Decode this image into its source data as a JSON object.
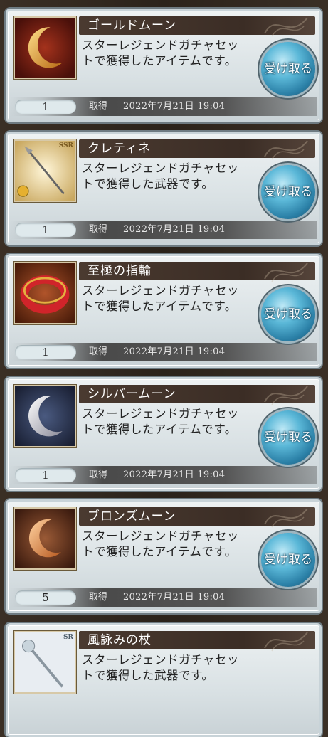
{
  "items": [
    {
      "name": "ゴールドムーン",
      "desc": "スターレジェンドガチャセットで獲得したアイテムです。",
      "qty": "1",
      "acq_label": "取得",
      "date": "2022年7月21日 19:04",
      "button": "受け取る",
      "icon": "gold-moon-icon",
      "colors": {
        "bg": "#7a1e12",
        "fg": "#e8a83a"
      }
    },
    {
      "name": "クレティネ",
      "desc": "スターレジェンドガチャセットで獲得した武器です。",
      "qty": "1",
      "acq_label": "取得",
      "date": "2022年7月21日 19:04",
      "button": "受け取る",
      "icon": "spear-icon",
      "badge": "SSR",
      "colors": {
        "bg": "#e9d9a8",
        "fg": "#8b8b8b"
      }
    },
    {
      "name": "至極の指輪",
      "desc": "スターレジェンドガチャセットで獲得したアイテムです。",
      "qty": "1",
      "acq_label": "取得",
      "date": "2022年7月21日 19:04",
      "button": "受け取る",
      "icon": "red-ring-icon",
      "colors": {
        "bg": "#7a3414",
        "fg": "#d0242a"
      }
    },
    {
      "name": "シルバームーン",
      "desc": "スターレジェンドガチャセットで獲得したアイテムです。",
      "qty": "1",
      "acq_label": "取得",
      "date": "2022年7月21日 19:04",
      "button": "受け取る",
      "icon": "silver-moon-icon",
      "colors": {
        "bg": "#2a3550",
        "fg": "#d8d8e0"
      }
    },
    {
      "name": "ブロンズムーン",
      "desc": "スターレジェンドガチャセットで獲得したアイテムです。",
      "qty": "5",
      "acq_label": "取得",
      "date": "2022年7月21日 19:04",
      "button": "受け取る",
      "icon": "bronze-moon-icon",
      "colors": {
        "bg": "#5a2e1c",
        "fg": "#e08a4a"
      }
    },
    {
      "name": "風詠みの杖",
      "desc": "スターレジェンドガチャセットで獲得した武器です。",
      "qty": "",
      "acq_label": "",
      "date": "",
      "button": "",
      "icon": "staff-icon",
      "badge": "SR",
      "colors": {
        "bg": "#dfe6ec",
        "fg": "#9aa6b0"
      }
    }
  ]
}
